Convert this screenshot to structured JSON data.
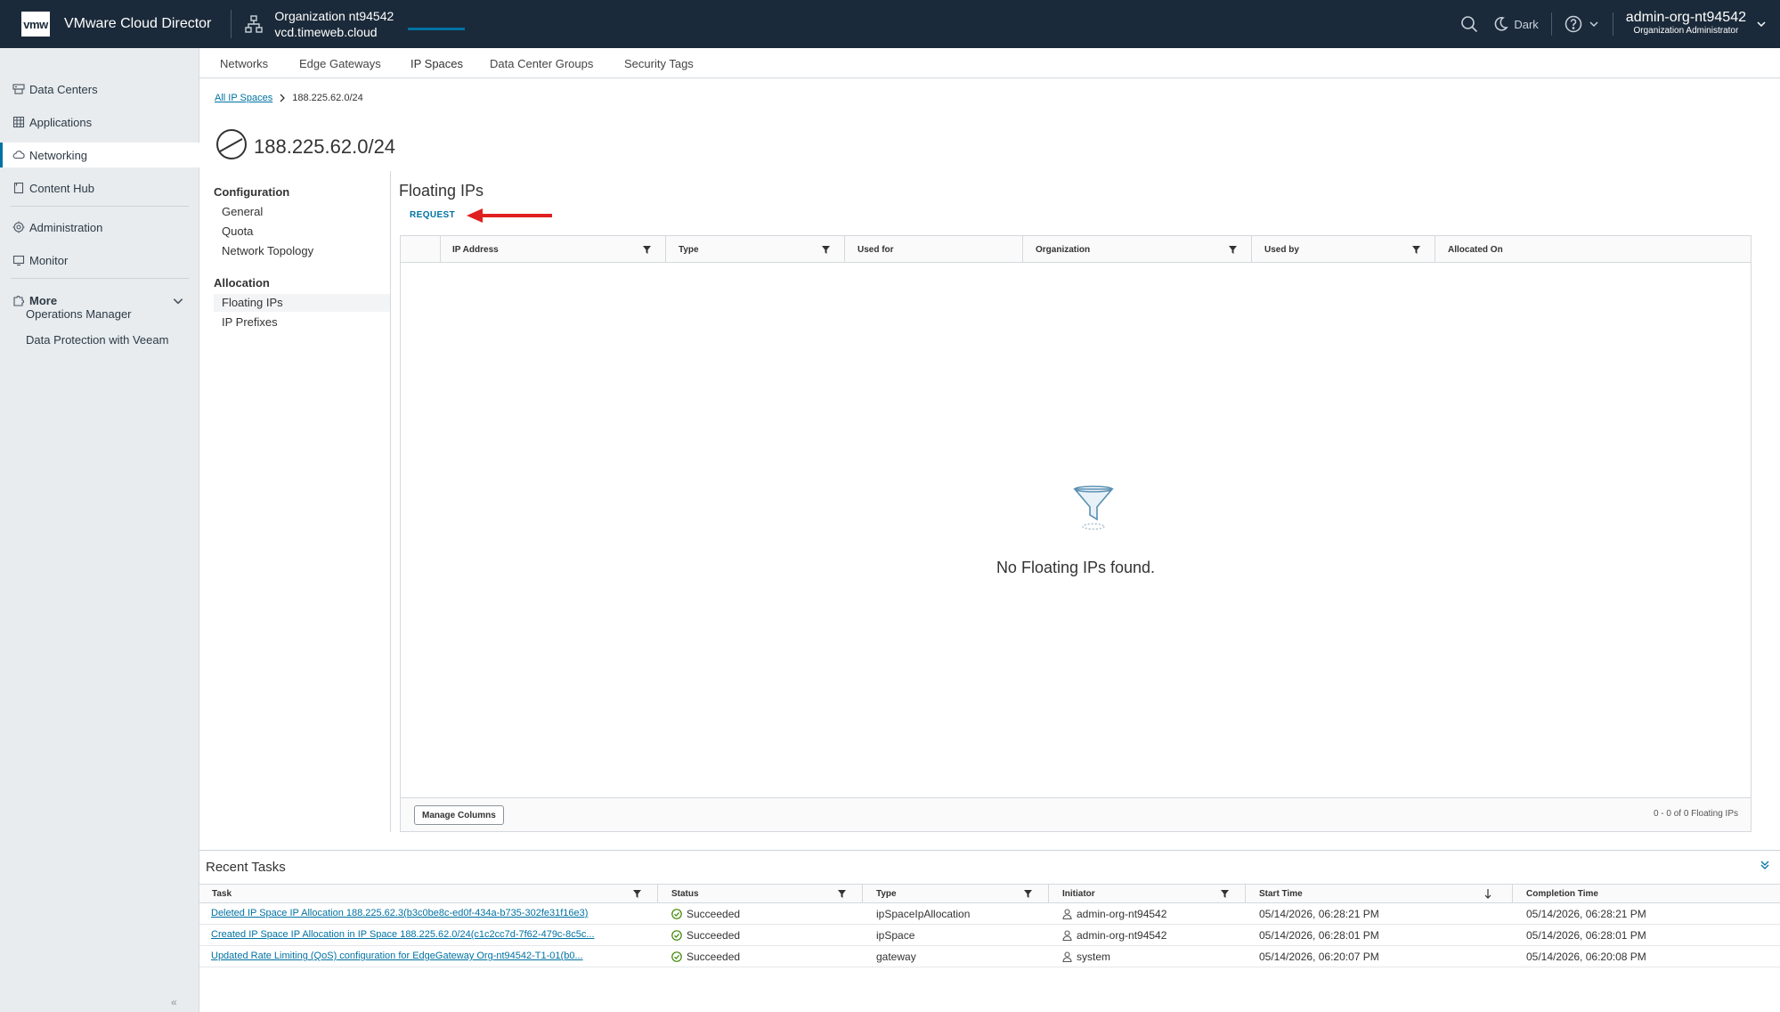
{
  "header": {
    "logo": "vmw",
    "app_title": "VMware Cloud Director",
    "org_name": "Organization nt94542",
    "org_domain": "vcd.timeweb.cloud",
    "dark_label": "Dark",
    "user_name": "admin-org-nt94542",
    "user_role": "Organization Administrator",
    "icons": [
      "search-icon",
      "moon-icon",
      "help-icon",
      "chevron-down-icon"
    ]
  },
  "sidebar": {
    "items": [
      {
        "label": "Data Centers",
        "icon": "datacenter-icon"
      },
      {
        "label": "Applications",
        "icon": "applications-icon"
      },
      {
        "label": "Networking",
        "icon": "cloud-network-icon",
        "active": true
      },
      {
        "label": "Content Hub",
        "icon": "content-hub-icon"
      },
      {
        "label": "Administration",
        "icon": "gear-icon"
      },
      {
        "label": "Monitor",
        "icon": "monitor-icon"
      }
    ],
    "more_label": "More",
    "more_items": [
      "Operations Manager",
      "Data Protection with Veeam"
    ]
  },
  "subtabs": [
    "Networks",
    "Edge Gateways",
    "IP Spaces",
    "Data Center Groups",
    "Security Tags"
  ],
  "active_subtab": "IP Spaces",
  "breadcrumb": {
    "parent": "All IP Spaces",
    "current": "188.225.62.0/24"
  },
  "page_title": "188.225.62.0/24",
  "left_nav": {
    "configuration_heading": "Configuration",
    "configuration_items": [
      "General",
      "Quota",
      "Network Topology"
    ],
    "allocation_heading": "Allocation",
    "allocation_items": [
      "Floating IPs",
      "IP Prefixes"
    ],
    "active_item": "Floating IPs"
  },
  "content": {
    "title": "Floating IPs",
    "request_label": "REQUEST",
    "columns": [
      "IP Address",
      "Type",
      "Used for",
      "Organization",
      "Used by",
      "Allocated On"
    ],
    "empty_text": "No Floating IPs found.",
    "manage_columns_label": "Manage Columns",
    "pager_text": "0 - 0 of 0 Floating IPs"
  },
  "recent_tasks": {
    "title": "Recent Tasks",
    "columns": [
      "Task",
      "Status",
      "Type",
      "Initiator",
      "Start Time",
      "Completion Time"
    ],
    "rows": [
      {
        "task": "Deleted IP Space IP Allocation 188.225.62.3(b3c0be8c-ed0f-434a-b735-302fe31f16e3)",
        "status": "Succeeded",
        "type": "ipSpaceIpAllocation",
        "initiator": "admin-org-nt94542",
        "start": "05/14/2026, 06:28:21 PM",
        "completion": "05/14/2026, 06:28:21 PM"
      },
      {
        "task": "Created IP Space IP Allocation in IP Space 188.225.62.0/24(c1c2cc7d-7f62-479c-8c5c...",
        "status": "Succeeded",
        "type": "ipSpace",
        "initiator": "admin-org-nt94542",
        "start": "05/14/2026, 06:28:01 PM",
        "completion": "05/14/2026, 06:28:01 PM"
      },
      {
        "task": "Updated Rate Limiting (QoS) configuration for EdgeGateway Org-nt94542-T1-01(b0...",
        "status": "Succeeded",
        "type": "gateway",
        "initiator": "system",
        "start": "05/14/2026, 06:20:07 PM",
        "completion": "05/14/2026, 06:20:08 PM"
      }
    ]
  },
  "colors": {
    "header_bg": "#1b2a3a",
    "accent": "#0072a3",
    "success": "#3c8500",
    "annotation_arrow": "#e02020"
  }
}
